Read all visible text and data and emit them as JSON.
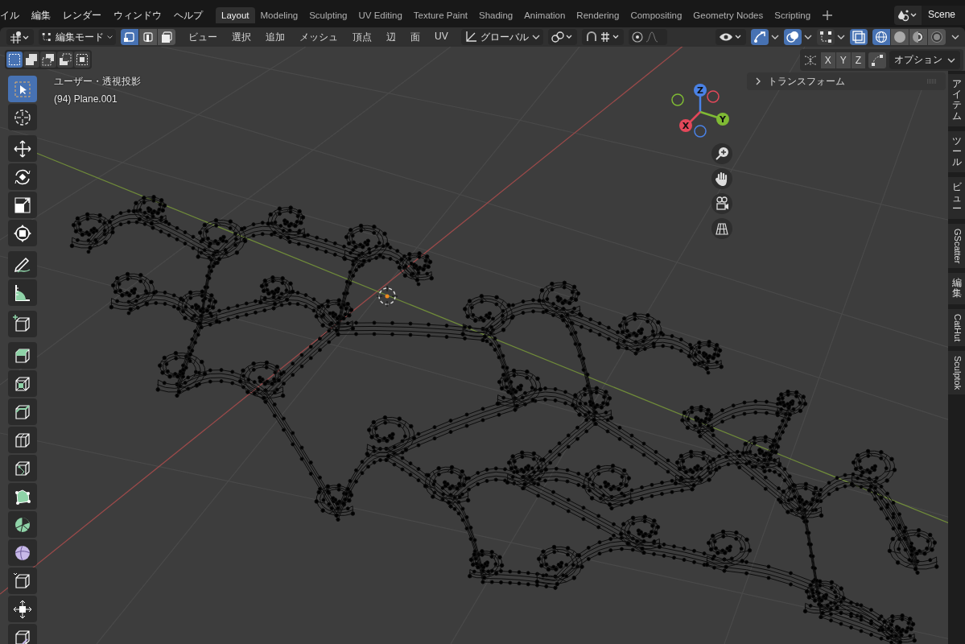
{
  "top_menu": [
    "イル",
    "編集",
    "レンダー",
    "ウィンドウ",
    "ヘルプ"
  ],
  "workspace_tabs": [
    {
      "label": "Layout",
      "selected": true
    },
    {
      "label": "Modeling",
      "selected": false
    },
    {
      "label": "Sculpting",
      "selected": false
    },
    {
      "label": "UV Editing",
      "selected": false
    },
    {
      "label": "Texture Paint",
      "selected": false
    },
    {
      "label": "Shading",
      "selected": false
    },
    {
      "label": "Animation",
      "selected": false
    },
    {
      "label": "Rendering",
      "selected": false
    },
    {
      "label": "Compositing",
      "selected": false
    },
    {
      "label": "Geometry Nodes",
      "selected": false
    },
    {
      "label": "Scripting",
      "selected": false
    }
  ],
  "scene": {
    "name": "Scene"
  },
  "header": {
    "mode": "編集モード",
    "select_modes": [
      {
        "selected": true
      },
      {
        "selected": false
      },
      {
        "selected": false
      }
    ],
    "menus": [
      "ビュー",
      "選択",
      "追加",
      "メッシュ",
      "頂点",
      "辺",
      "面",
      "UV"
    ],
    "orientation": "グローバル",
    "toggles": [
      {
        "kind": "gizmo",
        "on": true
      },
      {
        "kind": "overlay",
        "on": true
      },
      {
        "kind": "mesh-overlay",
        "on": false
      },
      {
        "kind": "xray",
        "on": true
      }
    ],
    "shading": [
      {
        "kind": "wireframe",
        "selected": true
      },
      {
        "kind": "solid",
        "selected": false
      },
      {
        "kind": "material",
        "selected": false
      },
      {
        "kind": "rendered",
        "selected": false
      }
    ]
  },
  "tool_settings": {
    "select_box_modes": [
      {
        "selected": true
      },
      {
        "selected": false
      },
      {
        "selected": false
      },
      {
        "selected": false
      },
      {
        "selected": false
      }
    ],
    "axes": [
      "X",
      "Y",
      "Z"
    ],
    "options": "オプション"
  },
  "viewport": {
    "view": "ユーザー・透視投影",
    "object": "(94) Plane.001",
    "gizmo_axes": [
      {
        "label": "Z",
        "color": "#4a82e6"
      },
      {
        "label": "Y",
        "color": "#7fba34"
      },
      {
        "label": "X",
        "color": "#e4485a"
      }
    ]
  },
  "toolbar": [
    [
      {
        "kind": "select",
        "selected": true
      },
      {
        "kind": "cursor",
        "selected": false
      }
    ],
    [
      {
        "kind": "move",
        "selected": false
      },
      {
        "kind": "rotate",
        "selected": false
      },
      {
        "kind": "scale",
        "selected": false
      },
      {
        "kind": "transform",
        "selected": false
      }
    ],
    [
      {
        "kind": "annotate",
        "selected": false
      },
      {
        "kind": "measure",
        "selected": false
      }
    ],
    [
      {
        "kind": "add-cube",
        "selected": false
      }
    ],
    [
      {
        "kind": "extrude",
        "selected": false
      },
      {
        "kind": "inset",
        "selected": false
      },
      {
        "kind": "bevel",
        "selected": false
      },
      {
        "kind": "loop-cut",
        "selected": false
      },
      {
        "kind": "knife",
        "selected": false
      },
      {
        "kind": "poly-build",
        "selected": false
      },
      {
        "kind": "spin",
        "selected": false
      },
      {
        "kind": "smooth",
        "selected": false
      },
      {
        "kind": "shrink",
        "selected": false
      },
      {
        "kind": "randomize",
        "selected": false
      },
      {
        "kind": "rip",
        "selected": false
      }
    ]
  ],
  "n_panel": {
    "title": "トランスフォーム",
    "expanded": false
  },
  "side_tabs": [
    {
      "label": "アイテム",
      "kind": "cjk"
    },
    {
      "label": "ツール",
      "kind": "cjk"
    },
    {
      "label": "ビュー",
      "kind": "cjk"
    },
    {
      "label": "GScatter",
      "kind": "latin"
    },
    {
      "label": "編集",
      "kind": "cjk"
    },
    {
      "label": "CatHut",
      "kind": "latin"
    },
    {
      "label": "Sculptok",
      "kind": "latin"
    }
  ]
}
